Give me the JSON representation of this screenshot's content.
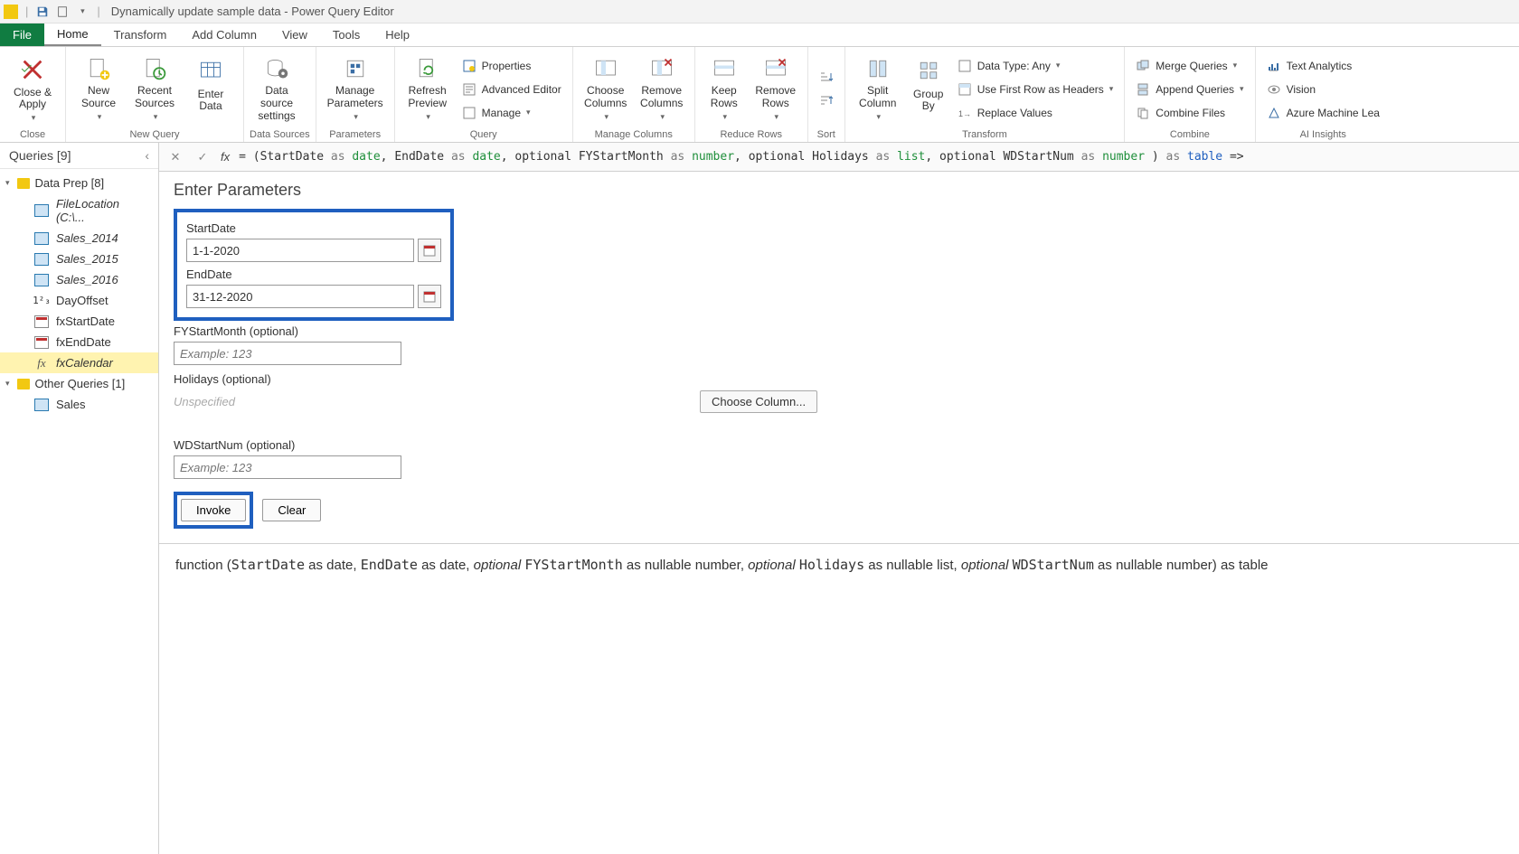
{
  "titlebar": {
    "title": "Dynamically update sample data - Power Query Editor"
  },
  "menu": {
    "file": "File",
    "tabs": [
      "Home",
      "Transform",
      "Add Column",
      "View",
      "Tools",
      "Help"
    ],
    "active": "Home"
  },
  "ribbon": {
    "close": {
      "label": "Close",
      "closeApply": "Close & Apply"
    },
    "newQuery": {
      "label": "New Query",
      "newSource": "New Source",
      "recentSources": "Recent Sources",
      "enterData": "Enter Data"
    },
    "dataSources": {
      "label": "Data Sources",
      "dataSourceSettings": "Data source settings"
    },
    "parameters": {
      "label": "Parameters",
      "manageParameters": "Manage Parameters"
    },
    "query": {
      "label": "Query",
      "refreshPreview": "Refresh Preview",
      "properties": "Properties",
      "advancedEditor": "Advanced Editor",
      "manage": "Manage"
    },
    "manageColumns": {
      "label": "Manage Columns",
      "chooseColumns": "Choose Columns",
      "removeColumns": "Remove Columns"
    },
    "reduceRows": {
      "label": "Reduce Rows",
      "keepRows": "Keep Rows",
      "removeRows": "Remove Rows"
    },
    "sort": {
      "label": "Sort"
    },
    "transform": {
      "label": "Transform",
      "splitColumn": "Split Column",
      "groupBy": "Group By",
      "dataType": "Data Type: Any",
      "useFirstRow": "Use First Row as Headers",
      "replaceValues": "Replace Values"
    },
    "combine": {
      "label": "Combine",
      "mergeQueries": "Merge Queries",
      "appendQueries": "Append Queries",
      "combineFiles": "Combine Files"
    },
    "ai": {
      "label": "AI Insights",
      "textAnalytics": "Text Analytics",
      "vision": "Vision",
      "azureML": "Azure Machine Lea"
    }
  },
  "formula": {
    "prefix": "= (StartDate ",
    "as1": "as",
    "t1": "date",
    "c1": ", EndDate ",
    "as2": "as",
    "t2": "date",
    "c2": ", optional FYStartMonth ",
    "as3": "as",
    "t3": "number",
    "c3": ", optional Holidays ",
    "as4": "as",
    "t4": "list",
    "c4": ", optional WDStartNum ",
    "as5": "as",
    "t5": "number",
    "c5": " ) ",
    "as6": "as",
    "t6": "table",
    "arrow": " =>"
  },
  "sidebar": {
    "title": "Queries [9]",
    "groups": [
      {
        "label": "Data Prep [8]",
        "items": [
          {
            "icon": "table",
            "label": "FileLocation (C:\\...",
            "italic": true
          },
          {
            "icon": "table",
            "label": "Sales_2014",
            "italic": true
          },
          {
            "icon": "table",
            "label": "Sales_2015",
            "italic": true
          },
          {
            "icon": "table",
            "label": "Sales_2016",
            "italic": true
          },
          {
            "icon": "num",
            "label": "DayOffset"
          },
          {
            "icon": "cal",
            "label": "fxStartDate"
          },
          {
            "icon": "cal",
            "label": "fxEndDate"
          },
          {
            "icon": "fx",
            "label": "fxCalendar",
            "selected": true
          }
        ]
      },
      {
        "label": "Other Queries [1]",
        "items": [
          {
            "icon": "table",
            "label": "Sales"
          }
        ]
      }
    ]
  },
  "params": {
    "heading": "Enter Parameters",
    "startDateLabel": "StartDate",
    "startDateValue": "1-1-2020",
    "endDateLabel": "EndDate",
    "endDateValue": "31-12-2020",
    "fyLabel": "FYStartMonth (optional)",
    "fyPlaceholder": "Example: 123",
    "holidaysLabel": "Holidays (optional)",
    "holidaysValue": "Unspecified",
    "chooseColumn": "Choose Column...",
    "wdLabel": "WDStartNum (optional)",
    "wdPlaceholder": "Example: 123",
    "invoke": "Invoke",
    "clear": "Clear"
  },
  "signature": {
    "p1": "function (",
    "s1": "StartDate",
    "p2": " as date, ",
    "s2": "EndDate",
    "p3": " as date, ",
    "o1": "optional ",
    "s3": "FYStartMonth",
    "p4": " as nullable number, ",
    "o2": "optional ",
    "s4": "Holidays",
    "p5": " as nullable list, ",
    "o3": "optional ",
    "s5": "WDStartNum",
    "p6": " as nullable number) as table"
  }
}
